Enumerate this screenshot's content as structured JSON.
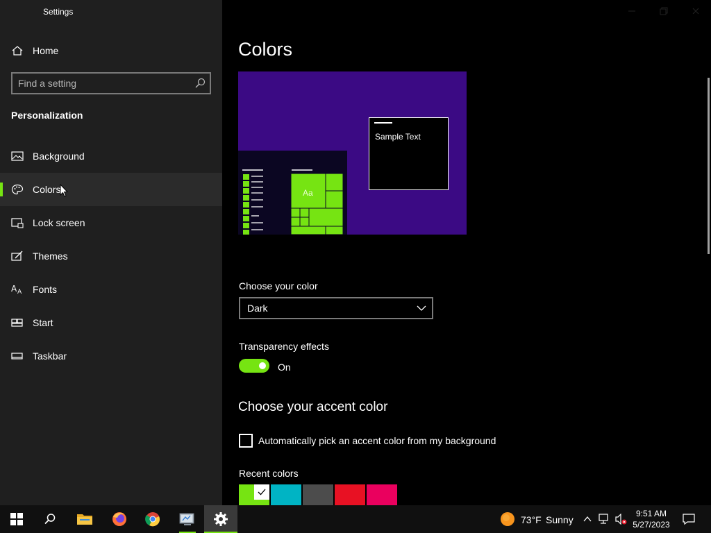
{
  "window": {
    "title": "Settings"
  },
  "sidebar": {
    "home_label": "Home",
    "search_placeholder": "Find a setting",
    "section": "Personalization",
    "items": [
      {
        "label": "Background",
        "icon": "image-icon"
      },
      {
        "label": "Colors",
        "icon": "palette-icon",
        "selected": true
      },
      {
        "label": "Lock screen",
        "icon": "lock-screen-icon"
      },
      {
        "label": "Themes",
        "icon": "themes-icon"
      },
      {
        "label": "Fonts",
        "icon": "fonts-icon"
      },
      {
        "label": "Start",
        "icon": "start-icon"
      },
      {
        "label": "Taskbar",
        "icon": "taskbar-icon"
      }
    ]
  },
  "main": {
    "title": "Colors",
    "preview": {
      "sample_text": "Sample Text",
      "tile_text": "Aa"
    },
    "choose_color_label": "Choose your color",
    "choose_color_value": "Dark",
    "transparency_label": "Transparency effects",
    "transparency_state": "On",
    "accent_heading": "Choose your accent color",
    "auto_pick_label": "Automatically pick an accent color from my background",
    "recent_colors_label": "Recent colors",
    "recent_colors": [
      "#76e412",
      "#00b4c4",
      "#4c4c4c",
      "#e81123",
      "#ea005e"
    ]
  },
  "taskbar": {
    "weather_temp": "73°F",
    "weather_text": "Sunny",
    "time": "9:51 AM",
    "date": "5/27/2023"
  },
  "colors": {
    "accent": "#76e412",
    "preview_bg": "#3b0a84",
    "sidebar_bg": "#1f1f1f"
  }
}
